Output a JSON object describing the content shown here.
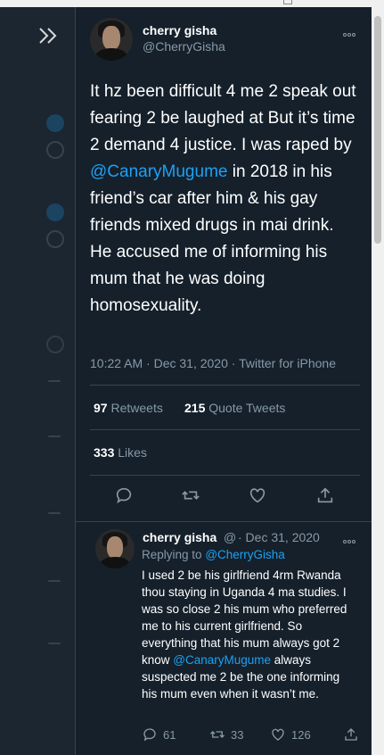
{
  "sidebar": {
    "expand_icon": "double-chevron-right-icon"
  },
  "tweet": {
    "author_name": "cherry gisha",
    "author_handle": "@CherryGisha",
    "text_part1": "It hz been difficult 4 me 2 speak out fearing 2 be laughed at But it’s time 2 demand 4 justice. I was raped by ",
    "mention": "@CanaryMugume",
    "text_part2": " in 2018 in his friend’s car after him & his gay friends mixed drugs in mai drink. He accused me of informing his mum that he was doing homosexuality.",
    "meta": "10:22 AM · Dec 31, 2020 · Twitter for iPhone",
    "retweets_count": "97",
    "retweets_label": "Retweets",
    "quotes_count": "215",
    "quotes_label": "Quote Tweets",
    "likes_count": "333",
    "likes_label": "Likes"
  },
  "reply": {
    "author_name": "cherry gisha",
    "author_handle": "@",
    "date": "· Dec 31, 2020",
    "replying_prefix": "Replying to",
    "replying_handle": "@CherryGisha",
    "text_part1": "I used 2 be his girlfriend 4rm Rwanda thou staying in Uganda 4 ma studies. I was so close 2 his mum who preferred me to his current girlfriend. So everything that his mum always got 2 know ",
    "mention": "@CanaryMugume",
    "text_part2": " always suspected me 2 be the one informing his mum even when it wasn’t me.",
    "replies": "61",
    "retweets": "33",
    "likes": "126"
  },
  "colors": {
    "background": "#15202b",
    "accent": "#1da1f2",
    "muted": "#8899a6",
    "border": "#38444d"
  }
}
